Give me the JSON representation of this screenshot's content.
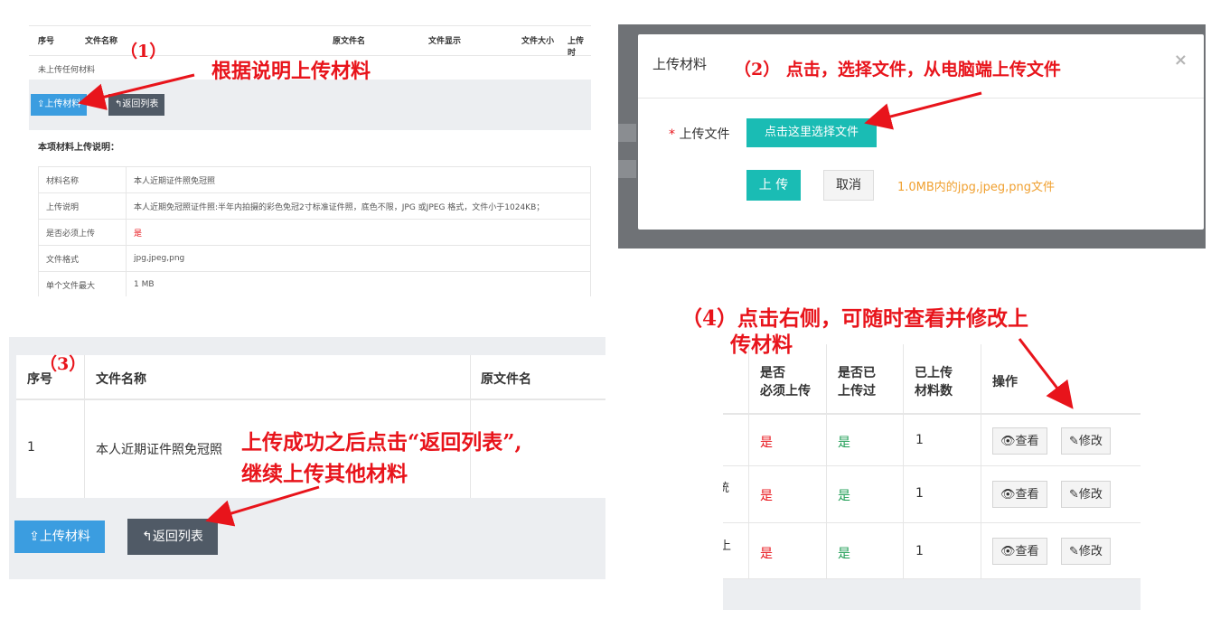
{
  "panel1": {
    "headers": [
      "序号",
      "文件名称",
      "原文件名",
      "文件显示",
      "文件大小",
      "上传时"
    ],
    "empty_text": "未上传任何材料",
    "upload_label": "上传材料",
    "back_label": "返回列表",
    "intro": "本项材料上传说明：",
    "rows": [
      {
        "k": "材料名称",
        "v": "本人近期证件照免冠照"
      },
      {
        "k": "上传说明",
        "v": "本人近期免冠照证件照:半年内拍摄的彩色免冠2寸标准证件照，底色不限，JPG 或JPEG 格式，文件小于1024KB；"
      },
      {
        "k": "是否必须上传",
        "v": "是"
      },
      {
        "k": "文件格式",
        "v": "jpg,jpeg,png"
      },
      {
        "k": "单个文件最大",
        "v": "1 MB"
      }
    ]
  },
  "panel2": {
    "title": "上传材料",
    "close": "×",
    "required_star": "*",
    "file_label": "上传文件",
    "choose_label": "点击这里选择文件",
    "upload_label": "上 传",
    "cancel_label": "取消",
    "hint": "1.0MB内的jpg,jpeg,png文件"
  },
  "panel3": {
    "headers": [
      "序号",
      "文件名称",
      "原文件名"
    ],
    "row": {
      "idx": "1",
      "name": "本人近期证件照免冠照"
    },
    "upload_label": "上传材料",
    "back_label": "返回列表"
  },
  "panel4": {
    "headers": {
      "required": [
        "是否",
        "必须上传"
      ],
      "uploaded": [
        "是否已",
        "上传过"
      ],
      "count": [
        "已上传",
        "材料数"
      ],
      "ops": "操作"
    },
    "rows": [
      {
        "edge": "",
        "required": "是",
        "uploaded": "是",
        "count": "1"
      },
      {
        "edge": "统",
        "required": "是",
        "uploaded": "是",
        "count": "1"
      },
      {
        "edge": "上",
        "required": "是",
        "uploaded": "是",
        "count": "1"
      }
    ],
    "view_label": "查看",
    "edit_label": "修改"
  },
  "annotations": {
    "a1_num": "（1）",
    "a1_text": "根据说明上传材料",
    "a2_text": "（2） 点击，选择文件，从电脑端上传文件",
    "a3_num": "（3）",
    "a3_line1": "上传成功之后点击“返回列表”,",
    "a3_line2": "继续上传其他材料",
    "a4_line1": "（4）点击右侧，可随时查看并修改上",
    "a4_line2": "传材料"
  },
  "colors": {
    "primary": "#3b9de0",
    "dark_button": "#505a66",
    "teal": "#1abcb4",
    "annotation": "#e8141b",
    "hint": "#f0a030",
    "green": "#1f9d55"
  }
}
